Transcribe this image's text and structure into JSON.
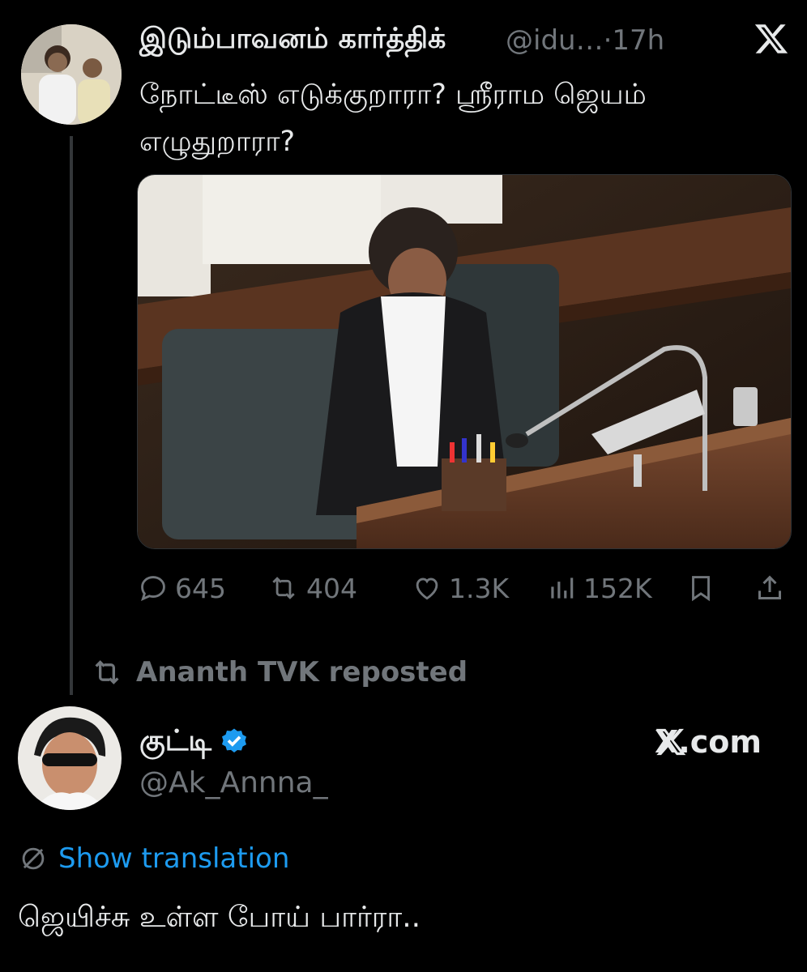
{
  "quoted_tweet": {
    "author_name": "இடும்பாவனம் கார்த்திக்",
    "handle": "@idu…",
    "time": "·17h",
    "text": "நோட்டீஸ் எடுக்குறாரா?  ஸ்ரீராம ஜெயம் எழுதுறாரா?",
    "image_description_icon": "photo-parliament-seat",
    "stats": {
      "replies": "645",
      "reposts": "404",
      "likes": "1.3K",
      "views": "152K"
    }
  },
  "repost_banner": {
    "text": "Ananth TVK reposted"
  },
  "main_tweet": {
    "author_name": "குட்டி",
    "handle": "@Ak_Annna_",
    "source_label": "X.com",
    "show_translation": "Show translation",
    "text": "ஜெயிச்சு உள்ள போய் பார்ரா.."
  },
  "colors": {
    "background": "#000000",
    "text": "#e7e9ea",
    "muted": "#71767b",
    "link": "#1d9bf0",
    "verified": "#1d9bf0"
  }
}
